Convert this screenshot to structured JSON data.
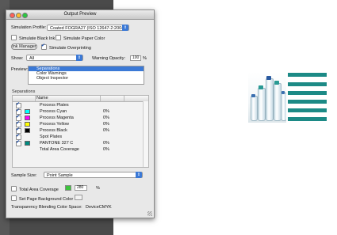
{
  "window": {
    "title": "Output Preview"
  },
  "simulation": {
    "profile_label": "Simulation Profile:",
    "profile_value": "Coated FOGRA27 (ISO 12647-2:2004)",
    "simulate_black_ink": "Simulate Black Ink",
    "simulate_paper_color": "Simulate Paper Color",
    "ink_manager": "Ink Manager",
    "simulate_overprinting": "Simulate Overprinting"
  },
  "show": {
    "label": "Show:",
    "value": "All",
    "warning_opacity_label": "Warning Opacity:",
    "warning_opacity_value": "100",
    "warning_opacity_unit": "%"
  },
  "preview": {
    "label": "Preview:",
    "items": [
      "Separations",
      "Color Warnings",
      "Object Inspector"
    ]
  },
  "separations": {
    "group_label": "Separations",
    "column_name": "Name",
    "rows": [
      {
        "name": "Process Plates",
        "value": "",
        "checked": true,
        "color": ""
      },
      {
        "name": "Process Cyan",
        "value": "0%",
        "checked": true,
        "color": "#00ffff"
      },
      {
        "name": "Process Magenta",
        "value": "0%",
        "checked": true,
        "color": "#ff00ff"
      },
      {
        "name": "Process Yellow",
        "value": "0%",
        "checked": true,
        "color": "#ffff00"
      },
      {
        "name": "Process Black",
        "value": "0%",
        "checked": true,
        "color": "#000000"
      },
      {
        "name": "Spot Plates",
        "value": "",
        "checked": true,
        "color": ""
      },
      {
        "name": "PANTONE 327 C",
        "value": "0%",
        "checked": true,
        "color": "#008b80"
      },
      {
        "name": "Total Area Coverage",
        "value": "0%",
        "checked": false,
        "color": ""
      }
    ]
  },
  "sample": {
    "label": "Sample Size:",
    "value": "Point Sample"
  },
  "total_area_coverage": {
    "label": "Total Area Coverage",
    "value": "280",
    "unit": "%"
  },
  "page_background": {
    "label": "Set Page Background Color"
  },
  "blending": {
    "label": "Transparency Blending Color Space:",
    "value": "DeviceCMYK"
  },
  "colors": {
    "accent": "#3b79d6",
    "teal": "#1c8a86",
    "tac_swatch": "#3cc43c"
  }
}
